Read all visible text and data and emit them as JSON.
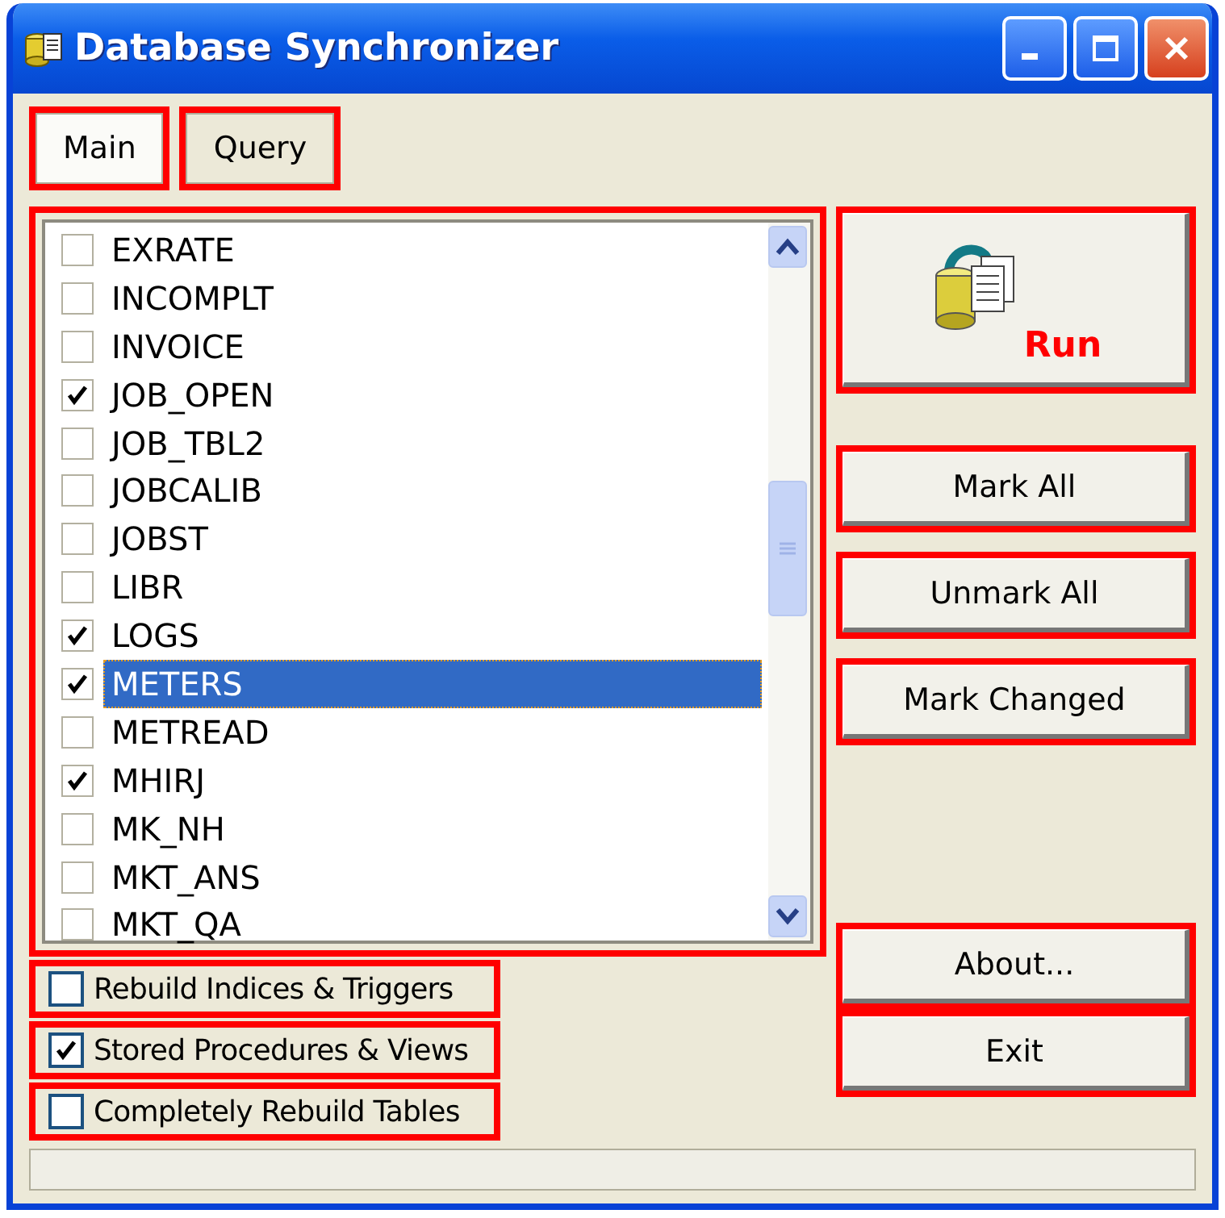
{
  "window": {
    "title": "Database Synchronizer"
  },
  "tabs": [
    {
      "label": "Main",
      "selected": true
    },
    {
      "label": "Query",
      "selected": false
    }
  ],
  "tables": [
    {
      "name": "EXRATE",
      "checked": false,
      "selected": false
    },
    {
      "name": "INCOMPLT",
      "checked": false,
      "selected": false
    },
    {
      "name": "INVOICE",
      "checked": false,
      "selected": false
    },
    {
      "name": "JOB_OPEN",
      "checked": true,
      "selected": false
    },
    {
      "name": "JOB_TBL2",
      "checked": false,
      "selected": false
    },
    {
      "name": "JOBCALIB",
      "checked": false,
      "selected": false
    },
    {
      "name": "JOBST",
      "checked": false,
      "selected": false
    },
    {
      "name": "LIBR",
      "checked": false,
      "selected": false
    },
    {
      "name": "LOGS",
      "checked": true,
      "selected": false
    },
    {
      "name": "METERS",
      "checked": true,
      "selected": true
    },
    {
      "name": "METREAD",
      "checked": false,
      "selected": false
    },
    {
      "name": "MHIRJ",
      "checked": true,
      "selected": false
    },
    {
      "name": "MK_NH",
      "checked": false,
      "selected": false
    },
    {
      "name": "MKT_ANS",
      "checked": false,
      "selected": false
    },
    {
      "name": "MKT_QA",
      "checked": false,
      "selected": false
    }
  ],
  "run_button": {
    "label": "Run"
  },
  "buttons": [
    {
      "label": "Mark All"
    },
    {
      "label": "Unmark All"
    },
    {
      "label": "Mark Changed"
    }
  ],
  "options": [
    {
      "label": "Rebuild Indices & Triggers",
      "checked": false
    },
    {
      "label": "Stored Procedures & Views",
      "checked": true
    },
    {
      "label": "Completely Rebuild Tables",
      "checked": false
    }
  ],
  "bottom_buttons": [
    {
      "label": "About..."
    },
    {
      "label": "Exit"
    }
  ]
}
